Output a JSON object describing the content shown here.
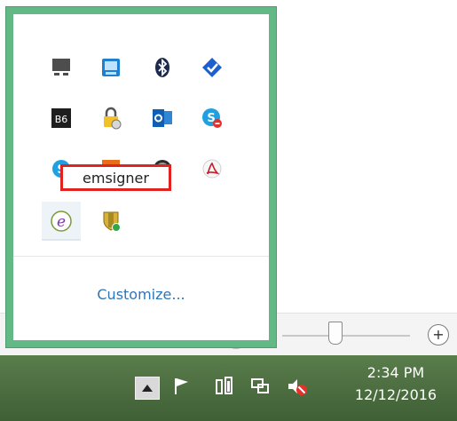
{
  "tray": {
    "customize_label": "Customize...",
    "tooltip_text": "emsigner",
    "icons": [
      {
        "name": "monitor-icon"
      },
      {
        "name": "keyboard-app-icon"
      },
      {
        "name": "bluetooth-icon"
      },
      {
        "name": "checkmark-shield-icon"
      },
      {
        "name": "bs-app-icon",
        "text": "B6"
      },
      {
        "name": "padlock-icon"
      },
      {
        "name": "outlook-icon"
      },
      {
        "name": "skype-busy-icon"
      },
      {
        "name": "skype-icon"
      },
      {
        "name": "orange-app-icon"
      },
      {
        "name": "swirl-icon"
      },
      {
        "name": "acrobat-icon"
      },
      {
        "name": "emsigner-icon",
        "text": "e"
      },
      {
        "name": "shield-green-dot-icon"
      }
    ]
  },
  "taskbar": {
    "time": "2:34 PM",
    "date": "12/12/2016",
    "icons": [
      {
        "name": "show-hidden-chevron-icon"
      },
      {
        "name": "flag-icon"
      },
      {
        "name": "battery-icon"
      },
      {
        "name": "network-icon"
      },
      {
        "name": "muted-speaker-icon"
      }
    ]
  },
  "zoom": {
    "plus_label": "+"
  },
  "colors": {
    "tray_border": "#62b986",
    "tooltip_border": "#e0231f",
    "link": "#2f76b8",
    "taskbar": "#4a6c3f"
  }
}
